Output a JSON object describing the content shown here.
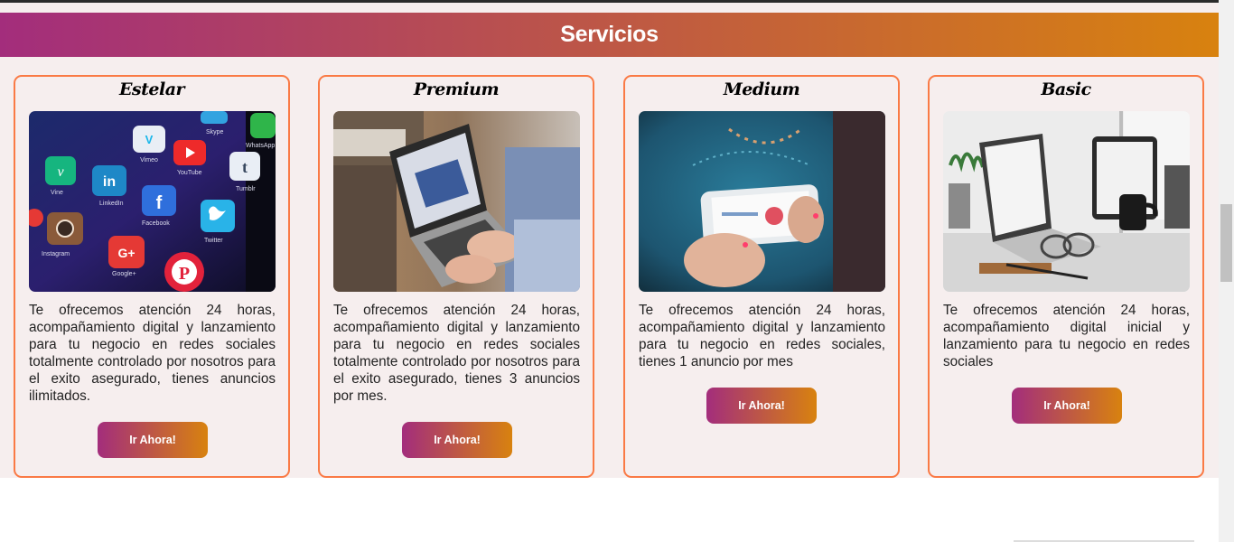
{
  "header": {
    "title": "Servicios"
  },
  "colors": {
    "gradient_start": "#a32d7c",
    "gradient_end": "#d8820f",
    "card_border": "#fa7a45",
    "section_bg": "#f6eeee"
  },
  "cards": [
    {
      "title": "Estelar",
      "description": "Te ofrecemos atención 24 horas, acompañamiento digital y lanzamiento para tu negocio en redes sociales totalmente controlado por nosotros para el exito asegurado, tienes anuncios ilimitados.",
      "button": "Ir Ahora!",
      "image": "phone-social-apps-photo",
      "app_labels": [
        "Vimeo",
        "YouTube",
        "Tumblr",
        "LinkedIn",
        "Facebook",
        "Twitter",
        "Instagram",
        "Google+",
        "Vine",
        "WhatsApp",
        "Skype"
      ]
    },
    {
      "title": "Premium",
      "description": "Te ofrecemos atención 24 horas, acompañamiento digital y lanzamiento para tu negocio en redes sociales totalmente controlado por nosotros para el exito asegurado, tienes 3 anuncios por mes.",
      "button": "Ir Ahora!",
      "image": "laptop-typing-photo"
    },
    {
      "title": "Medium",
      "description": "Te ofrecemos atención 24 horas, acompañamiento digital y lanzamiento para tu negocio en redes sociales, tienes 1 anuncio por mes",
      "button": "Ir Ahora!",
      "image": "hand-holding-phone-photo"
    },
    {
      "title": "Basic",
      "description": "Te ofrecemos atención 24 horas, acompañamiento digital inicial y lanzamiento para tu negocio en redes sociales",
      "button": "Ir Ahora!",
      "image": "laptop-tablet-desk-photo"
    }
  ]
}
